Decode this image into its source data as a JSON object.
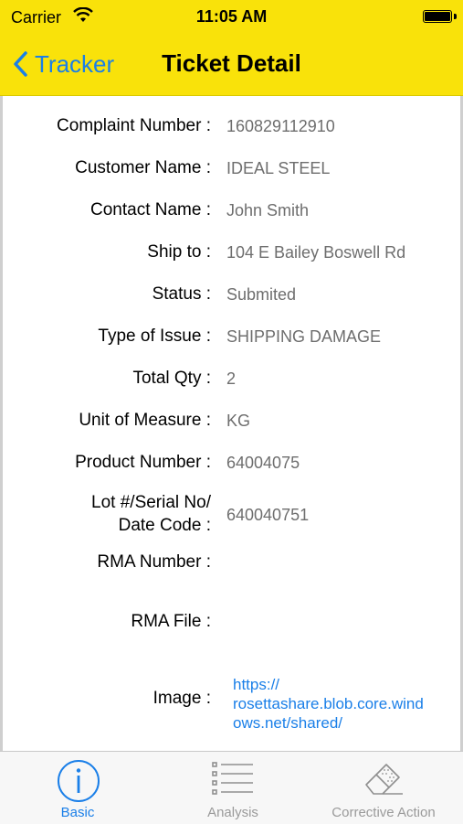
{
  "status_bar": {
    "carrier": "Carrier",
    "time": "11:05 AM"
  },
  "nav": {
    "back_label": "Tracker",
    "title": "Ticket Detail"
  },
  "fields": [
    {
      "label": "Complaint Number :",
      "value": "160829112910"
    },
    {
      "label": "Customer Name :",
      "value": "IDEAL STEEL"
    },
    {
      "label": "Contact Name :",
      "value": "John Smith"
    },
    {
      "label": "Ship to :",
      "value": "104 E Bailey Boswell Rd"
    },
    {
      "label": "Status :",
      "value": "Submited"
    },
    {
      "label": "Type of Issue :",
      "value": "SHIPPING DAMAGE"
    },
    {
      "label": "Total Qty :",
      "value": "2"
    },
    {
      "label": "Unit of Measure :",
      "value": "KG"
    },
    {
      "label": "Product Number :",
      "value": "64004075"
    },
    {
      "label_line1": "Lot #/Serial No/",
      "label_line2": "Date Code :",
      "value": "640040751"
    },
    {
      "label": "RMA Number :",
      "value": ""
    },
    {
      "label": "RMA File :",
      "value": ""
    },
    {
      "label": "Image :",
      "link_line1": "https://",
      "link_line2": "rosettashare.blob.core.wind",
      "link_line3": "ows.net/shared/"
    }
  ],
  "tabs": [
    {
      "label": "Basic",
      "icon": "info-icon",
      "active": true
    },
    {
      "label": "Analysis",
      "icon": "list-icon",
      "active": false
    },
    {
      "label": "Corrective Action",
      "icon": "eraser-icon",
      "active": false
    }
  ],
  "colors": {
    "accent": "#1a7fe8",
    "header": "#f9e20a"
  }
}
